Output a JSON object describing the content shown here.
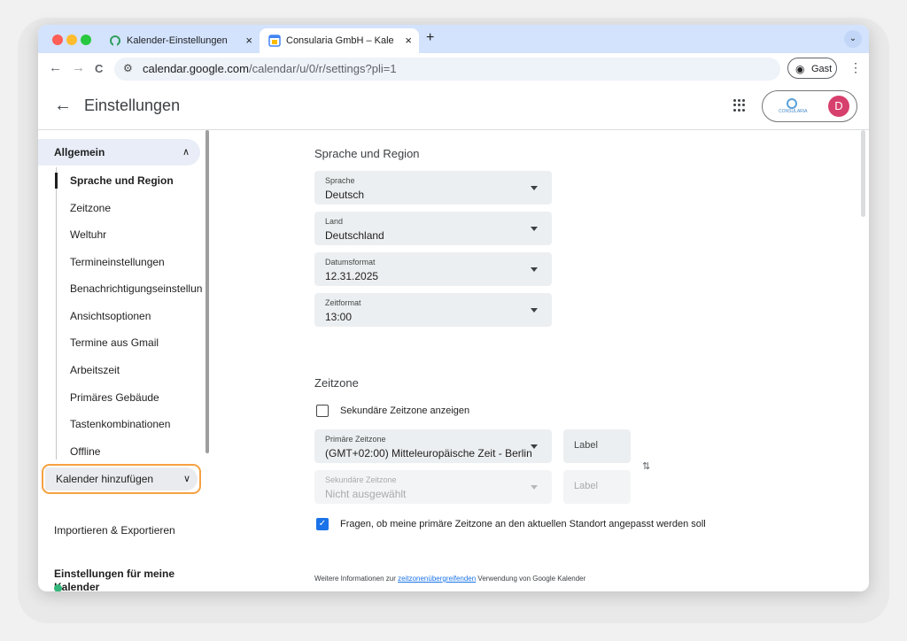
{
  "browser": {
    "tabs": [
      {
        "label": "Kalender-Einstellungen",
        "close": "×"
      },
      {
        "label": "Consularia GmbH – Kalender",
        "close": "×"
      }
    ],
    "new_tab": "+",
    "tab_menu": "⌄",
    "nav": {
      "back": "←",
      "forward": "→",
      "reload": "C"
    },
    "url_host": "calendar.google.com",
    "url_path": "/calendar/u/0/r/settings?pli=1",
    "profile_label": "Gast",
    "menu": "⋮"
  },
  "header": {
    "back": "←",
    "title": "Einstellungen",
    "account_logo_text": "CONSULARIA",
    "avatar_letter": "D"
  },
  "sidebar": {
    "group": {
      "label": "Allgemein",
      "chevron": "∧"
    },
    "items": [
      "Sprache und Region",
      "Zeitzone",
      "Weltuhr",
      "Termineinstellungen",
      "Benachrichtigungseinstellungen",
      "Ansichtsoptionen",
      "Termine aus Gmail",
      "Arbeitszeit",
      "Primäres Gebäude",
      "Tastenkombinationen",
      "Offline"
    ],
    "add_calendar": {
      "label": "Kalender hinzufügen",
      "chevron": "∨"
    },
    "import_export": "Importieren & Exportieren",
    "my_calendars_heading": "Einstellungen für meine Kalender"
  },
  "main": {
    "language_region": {
      "title": "Sprache und Region",
      "fields": [
        {
          "label": "Sprache",
          "value": "Deutsch"
        },
        {
          "label": "Land",
          "value": "Deutschland"
        },
        {
          "label": "Datumsformat",
          "value": "12.31.2025"
        },
        {
          "label": "Zeitformat",
          "value": "13:00"
        }
      ]
    },
    "timezone": {
      "title": "Zeitzone",
      "secondary_checkbox_label": "Sekundäre Zeitzone anzeigen",
      "secondary_checked": false,
      "primary": {
        "label": "Primäre Zeitzone",
        "value": "(GMT+02:00) Mitteleuropäische Zeit - Berlin",
        "label_field": "Label"
      },
      "secondary": {
        "label": "Sekundäre Zeitzone",
        "value": "Nicht ausgewählt",
        "label_field": "Label"
      },
      "swap_icon": "⇅",
      "ask_checkbox_label": "Fragen, ob meine primäre Zeitzone an den aktuellen Standort angepasst werden soll",
      "ask_checked": true,
      "check_mark": "✓",
      "info_prefix": "Weitere Informationen zur ",
      "info_link": "zeitzonenübergreifenden",
      "info_suffix": " Verwendung von Google Kalender"
    }
  },
  "colors": {
    "accent": "#1a73e8",
    "highlight_outline": "#f5a142",
    "avatar": "#d73f6d"
  }
}
